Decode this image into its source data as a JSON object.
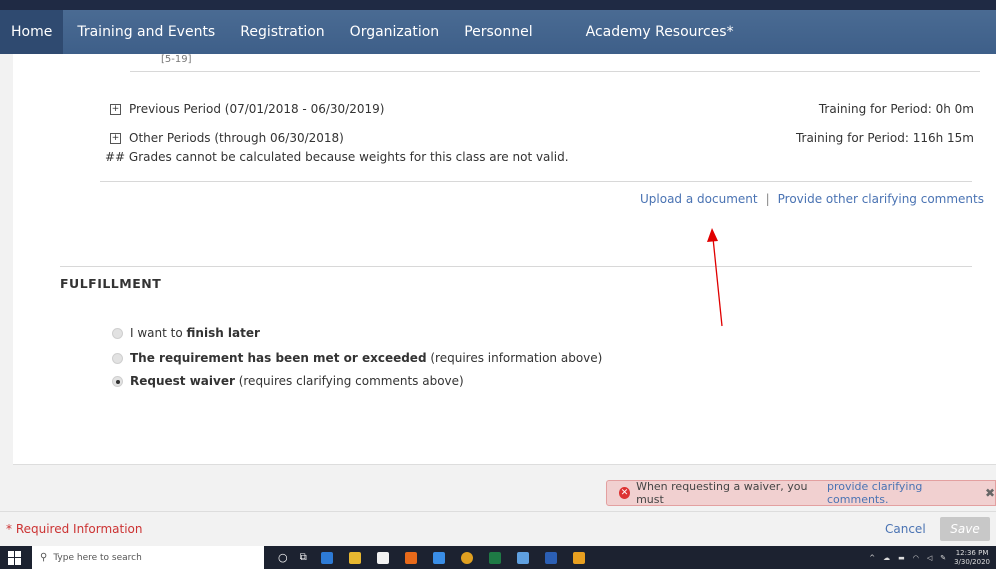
{
  "nav": {
    "items": [
      "Home",
      "Training and Events",
      "Registration",
      "Organization",
      "Personnel",
      "Academy Resources*"
    ]
  },
  "top": {
    "partial_text": "[5-19]"
  },
  "periods": [
    {
      "label": "Previous Period (07/01/2018 - 06/30/2019)",
      "training": "Training for Period: 0h 0m"
    },
    {
      "label": "Other Periods (through 06/30/2018)",
      "training": "Training for Period: 116h 15m"
    }
  ],
  "grades_note": "## Grades cannot be calculated because weights for this class are not valid.",
  "links": {
    "upload": "Upload a document",
    "separator": "|",
    "clarify": "Provide other clarifying comments"
  },
  "fulfillment": {
    "title": "FULFILLMENT",
    "options": [
      {
        "pre": "I want to ",
        "bold": "finish later",
        "post": "",
        "checked": false
      },
      {
        "pre": "",
        "bold": "The requirement has been met or exceeded",
        "post": " (requires information above)",
        "checked": false
      },
      {
        "pre": "",
        "bold": "Request waiver",
        "post": " (requires clarifying comments above)",
        "checked": true
      }
    ]
  },
  "error": {
    "text": "When requesting a waiver, you must",
    "link": "provide clarifying comments.",
    "close": "✖"
  },
  "footer": {
    "required": "* Required Information",
    "cancel": "Cancel",
    "save": "Save"
  },
  "taskbar": {
    "search_placeholder": "Type here to search",
    "time": "12:36 PM",
    "date": "3/30/2020"
  },
  "colors": {
    "nav": "#3e5f89",
    "link": "#4a73b3",
    "error_bg": "#f1d0d0",
    "required": "#cc3333",
    "arrow": "#e00000"
  }
}
